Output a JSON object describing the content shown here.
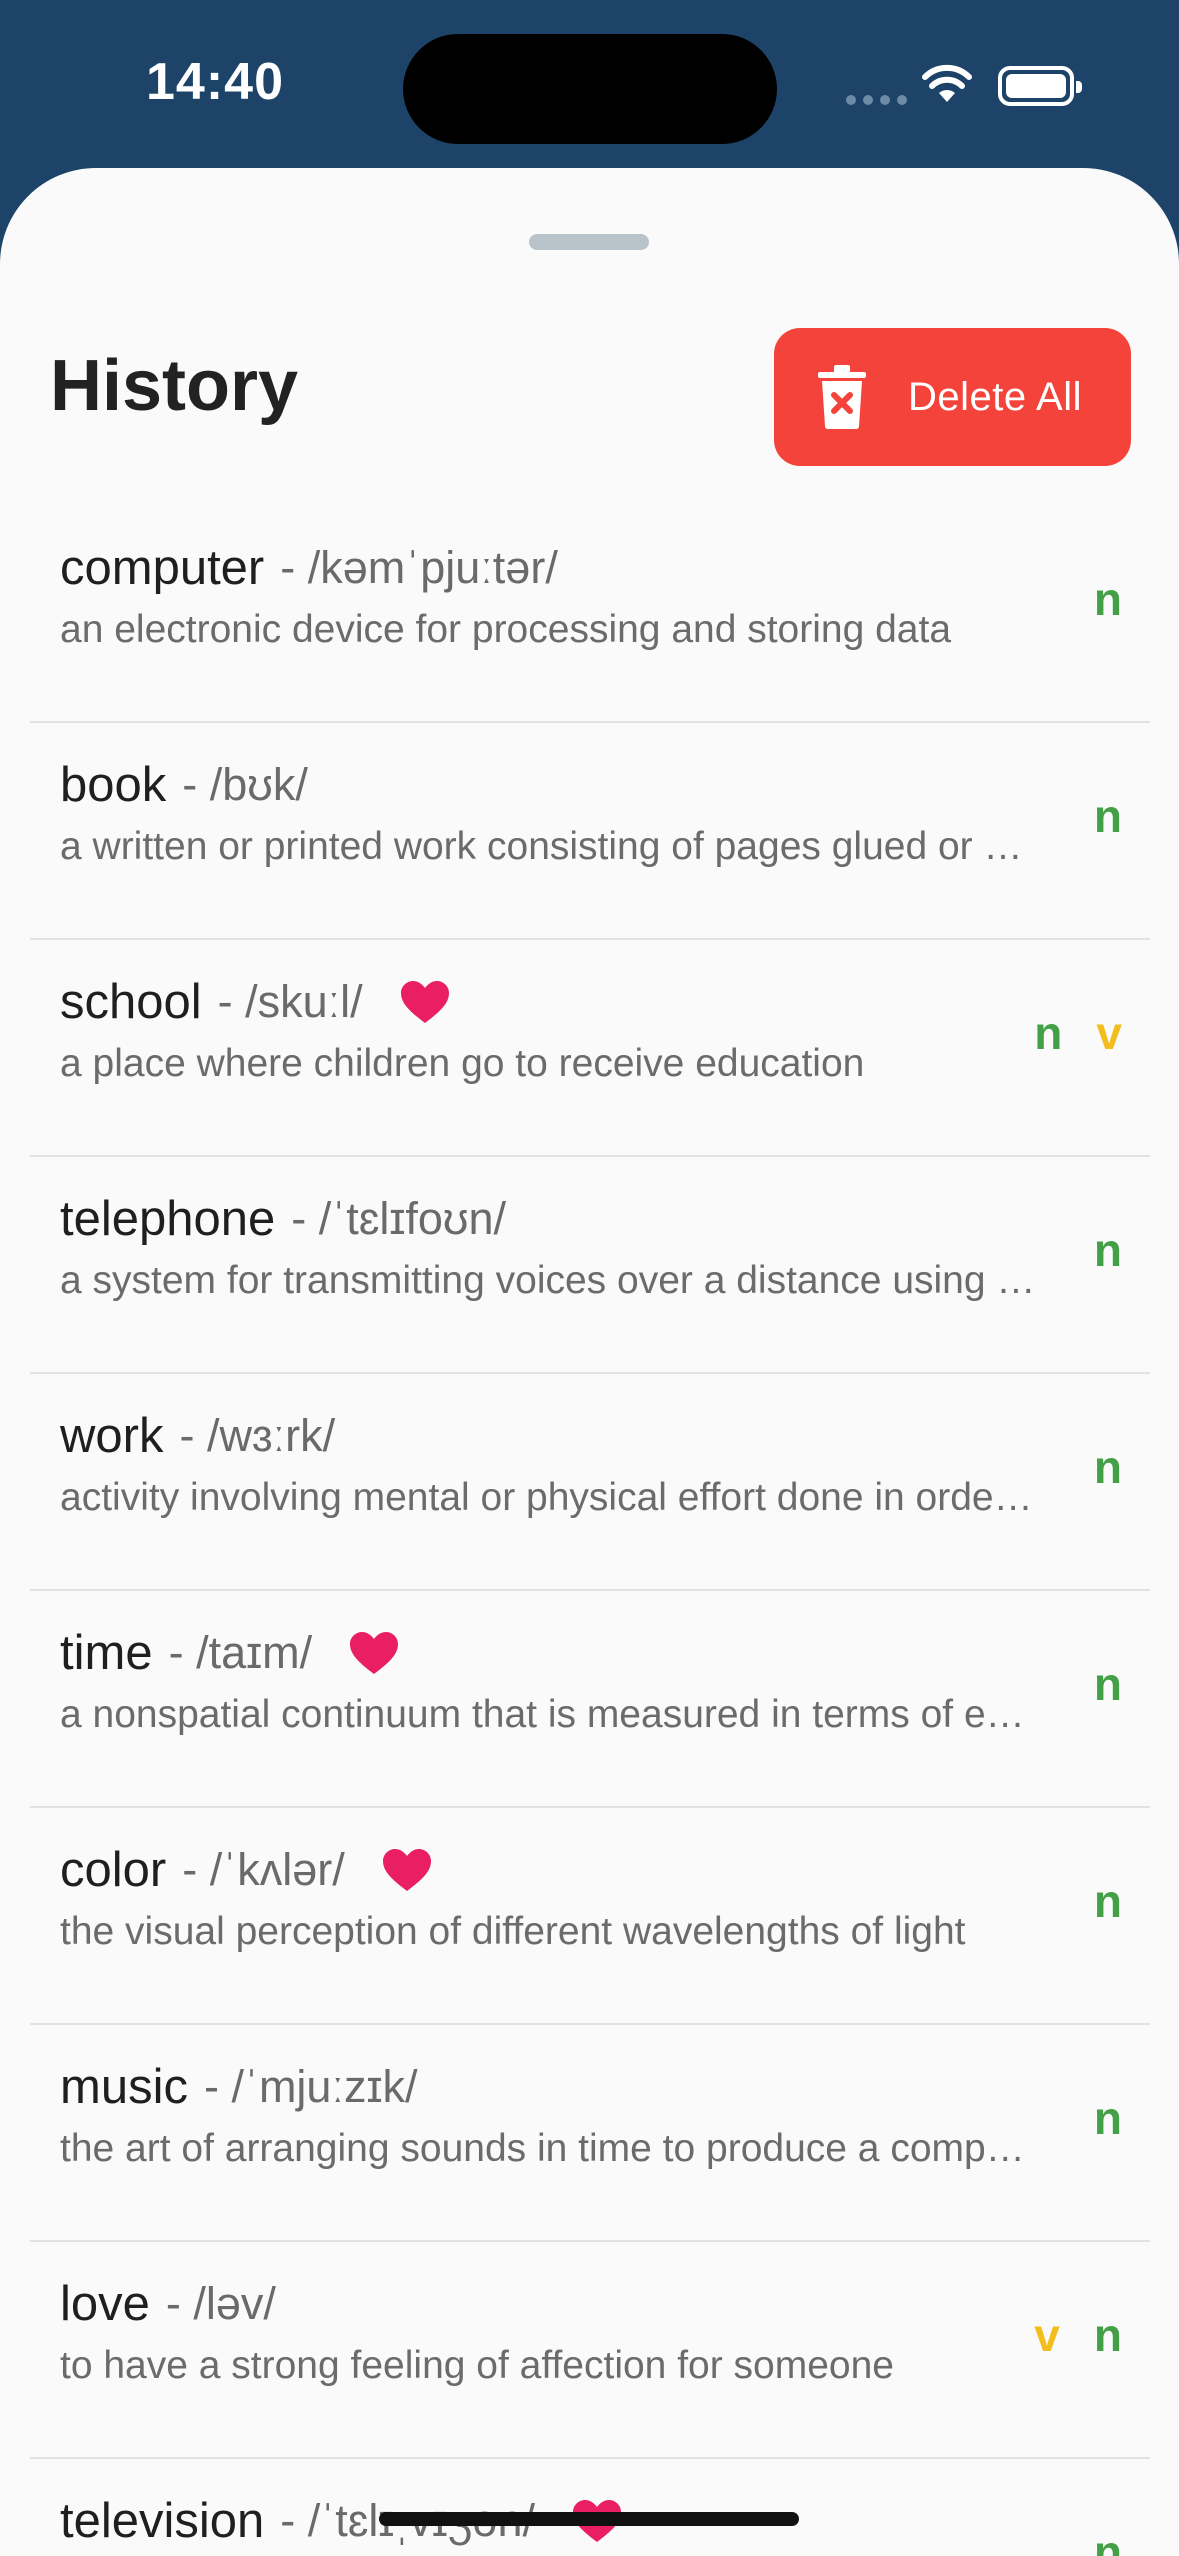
{
  "status_bar": {
    "time": "14:40"
  },
  "header": {
    "title": "History",
    "delete_all_label": "Delete All"
  },
  "colors": {
    "noun": "#43a047",
    "verb": "#f2bd1d",
    "favorite": "#e91e63",
    "delete": "#f4433a"
  },
  "items": [
    {
      "word": "computer",
      "phonetic": "- /kəmˈpjuːtər/",
      "favorite": false,
      "definition": "an electronic device for processing and storing data",
      "tags": [
        "n"
      ]
    },
    {
      "word": "book",
      "phonetic": "- /bʊk/",
      "favorite": false,
      "definition": "a written or printed work consisting of pages glued or sewn together",
      "tags": [
        "n"
      ]
    },
    {
      "word": "school",
      "phonetic": "- /skuːl/",
      "favorite": true,
      "definition": "a place where children go to receive education",
      "tags": [
        "n",
        "v"
      ]
    },
    {
      "word": "telephone",
      "phonetic": "- /ˈtɛlɪfoʊn/",
      "favorite": false,
      "definition": "a system for transmitting voices over a distance using wire or radio",
      "tags": [
        "n"
      ]
    },
    {
      "word": "work",
      "phonetic": "- /wɜːrk/",
      "favorite": false,
      "definition": "activity involving mental or physical effort done in order to achieve a result",
      "tags": [
        "n"
      ]
    },
    {
      "word": "time",
      "phonetic": "- /taɪm/",
      "favorite": true,
      "definition": "a nonspatial continuum that is measured in terms of events",
      "tags": [
        "n"
      ]
    },
    {
      "word": "color",
      "phonetic": "- /ˈkʌlər/",
      "favorite": true,
      "definition": "the visual perception of different wavelengths of light",
      "tags": [
        "n"
      ]
    },
    {
      "word": "music",
      "phonetic": "- /ˈmjuːzɪk/",
      "favorite": false,
      "definition": "the art of arranging sounds in time to produce a composition",
      "tags": [
        "n"
      ]
    },
    {
      "word": "love",
      "phonetic": "- /ləv/",
      "favorite": false,
      "definition": "to have a strong feeling of affection for someone",
      "tags": [
        "v",
        "n"
      ]
    },
    {
      "word": "television",
      "phonetic": "- /ˈtɛlɪˌvɪʒən/",
      "favorite": true,
      "definition": "",
      "tags": [
        "n"
      ]
    }
  ]
}
